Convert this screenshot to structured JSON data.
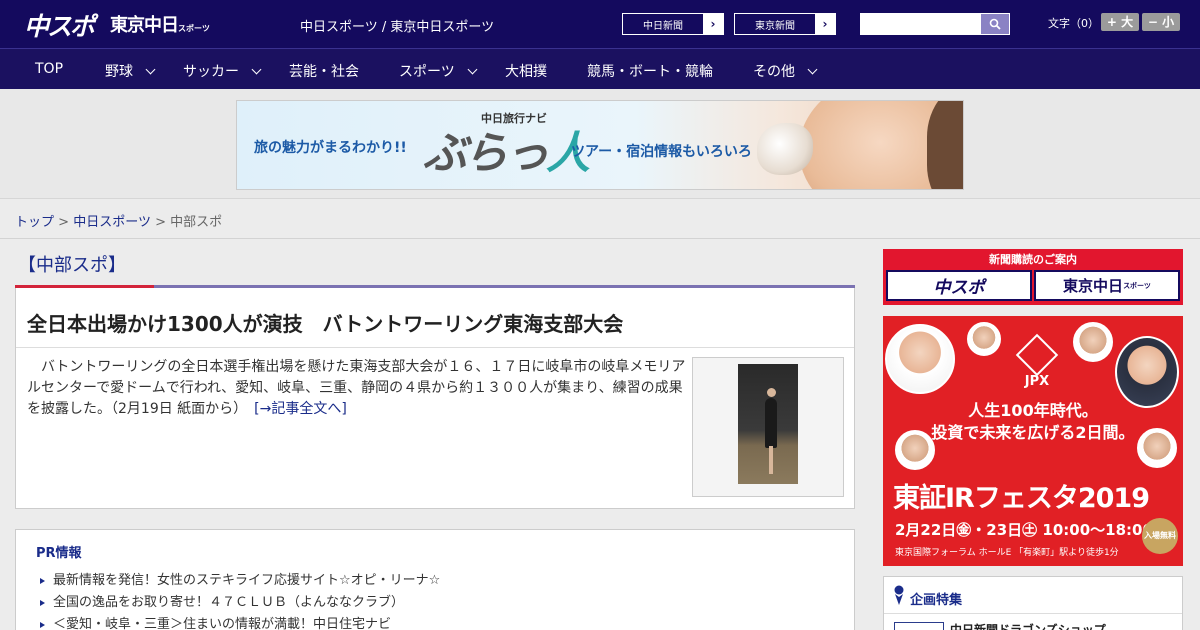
{
  "header": {
    "logo_chuspo": "中スポ",
    "logo_tokyo": "東京中日",
    "logo_tokyo_suffix": "スポーツ",
    "tagline": "中日スポーツ / 東京中日スポーツ",
    "btn_chunichi": "中日新聞",
    "btn_tokyo": "東京新聞",
    "search_placeholder": "",
    "fontsize_label": "文字（0）",
    "font_larger": "+ 大",
    "font_smaller": "− 小"
  },
  "nav": {
    "items": [
      {
        "label": "TOP",
        "chevron": false
      },
      {
        "label": "野球",
        "chevron": true
      },
      {
        "label": "サッカー",
        "chevron": true
      },
      {
        "label": "芸能・社会",
        "chevron": false
      },
      {
        "label": "スポーツ",
        "chevron": true
      },
      {
        "label": "大相撲",
        "chevron": false
      },
      {
        "label": "競馬・ボート・競輪",
        "chevron": false
      },
      {
        "label": "その他",
        "chevron": true
      }
    ]
  },
  "banner": {
    "lead": "旅の魅力がまるわかり!!",
    "brand_small": "中日旅行ナビ",
    "brand_main": "ぶらっ",
    "brand_accent": "人",
    "tail": "ツアー・宿泊情報もいろいろ"
  },
  "breadcrumb": {
    "home": "トップ",
    "section": "中日スポーツ",
    "current": "中部スポ",
    "separator": ">"
  },
  "section_title": "【中部スポ】",
  "article": {
    "headline": "全日本出場かけ1300人が演技　バトントワーリング東海支部大会",
    "body": "バトントワーリングの全日本選手権出場を懸けた東海支部大会が１６、１７日に岐阜市の岐阜メモリアルセンターで愛ドームで行われ、愛知、岐阜、三重、静岡の４県から約１３００人が集まり、練習の成果を披露した。（2月19日 紙面から）",
    "read_more": "[→記事全文へ]"
  },
  "pr": {
    "title": "PR情報",
    "items": [
      "最新情報を発信！女性のステキライフ応援サイト☆オピ・リーナ☆",
      "全国の逸品をお取り寄せ！４７ＣＬＵＢ（よんななクラブ）",
      "＜愛知・岐阜・三重＞住まいの情報が満載！中日住宅ナビ"
    ]
  },
  "subscribe": {
    "caption": "新聞購読のご案内",
    "box1": "中スポ",
    "box2": "東京中日",
    "box2_suffix": "スポーツ"
  },
  "ad": {
    "jpx": "JPX",
    "line1": "人生100年時代。",
    "line2": "投資で未来を広げる2日間。",
    "line3": "東証IRフェスタ2019",
    "line4": "2月22日㊎・23日㊏ 10:00～18:00",
    "line5": "東京国際フォーラム ホールE 「有楽町」駅より徒歩1分",
    "free": "入場無料"
  },
  "feature": {
    "title": "企画特集",
    "first_item": "中日新聞ドラゴンズショップ"
  },
  "colors": {
    "header_bg": "#140a5e",
    "nav_bg": "#1b1160",
    "link": "#1a2c8a",
    "accent_red": "#e2162e",
    "section_line": "#7b72b2"
  }
}
